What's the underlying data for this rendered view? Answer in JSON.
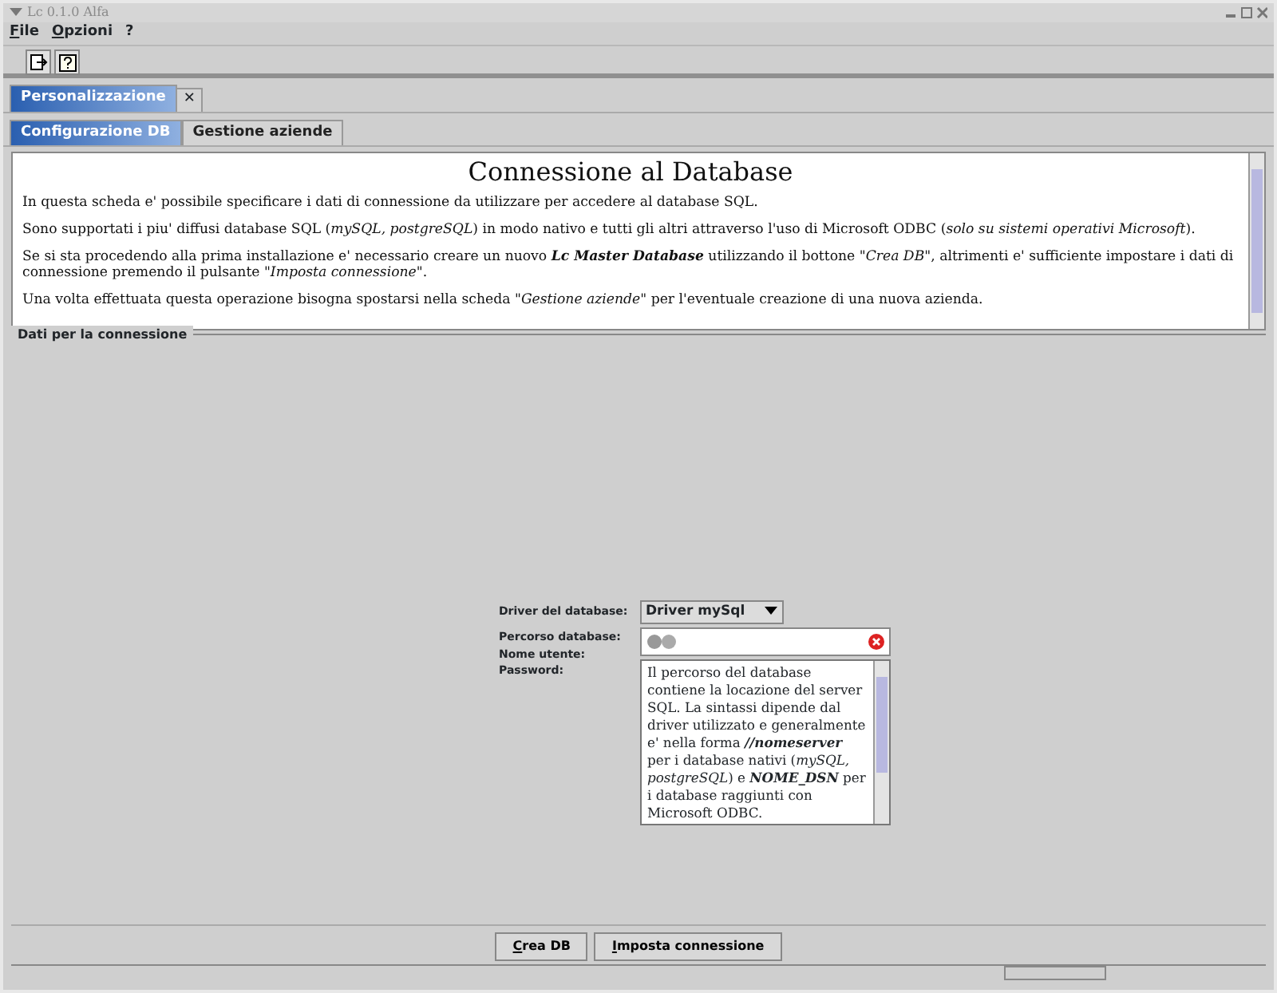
{
  "window": {
    "title": "Lc 0.1.0 Alfa"
  },
  "menu": [
    {
      "label": "File"
    },
    {
      "label": "Opzioni"
    },
    {
      "label": "?"
    }
  ],
  "toolbar": [
    {
      "kind": "exit"
    },
    {
      "kind": "help"
    }
  ],
  "main_tabs": [
    {
      "label": "Personalizzazione",
      "selected": true,
      "close": "✕"
    }
  ],
  "sub_tabs": [
    {
      "label": "Configurazione DB",
      "selected": true
    },
    {
      "label": "Gestione aziende",
      "selected": false
    }
  ],
  "info": {
    "heading": "Connessione al Database",
    "paragraphs": [
      "In questa scheda e' possibile specificare i dati di connessione da utilizzare per accedere al database SQL.",
      "Sono supportati i piu' diffusi database SQL (*mySQL, postgreSQL*) in modo nativo e tutti gli altri attraverso l'uso di Microsoft ODBC (*solo su sistemi operativi Microsoft*).",
      "Se si sta procedendo alla prima installazione e' necessario creare un nuovo **Lc Master Database** utilizzando il bottone \"*Crea DB*\", altrimenti e' sufficiente impostare i dati di connessione premendo il pulsante \"*Imposta connessione*\".",
      "Una volta effettuata questa operazione bisogna spostarsi nella scheda \"*Gestione aziende*\" per l'eventuale creazione di una nuova azienda."
    ]
  },
  "connection": {
    "legend": "Dati per la connessione",
    "labels": [
      "Driver del database:",
      "Percorso database:",
      "Nome utente:",
      "Password:"
    ],
    "driver": {
      "value": "Driver mySql"
    },
    "help_text": "Il percorso del database contiene la locazione del server SQL. La sintassi dipende dal driver utilizzato e generalmente e' nella forma **//nomeserver** per i database nativi (*mySQL, postgreSQL*) e **NOME_DSN** per i database raggiunti con Microsoft ODBC."
  },
  "buttons": [
    {
      "label": "Crea DB"
    },
    {
      "label": "Imposta connessione"
    }
  ]
}
